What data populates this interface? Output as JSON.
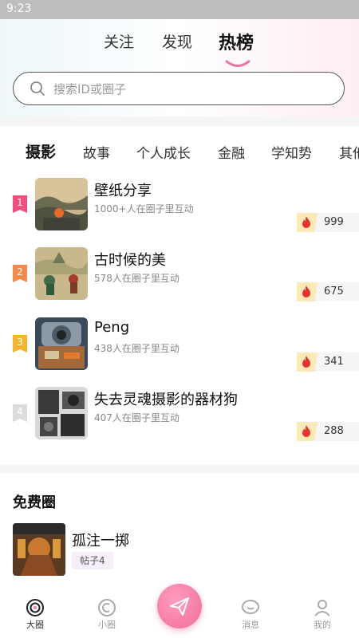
{
  "status_bar": {
    "time": "9:23"
  },
  "top_tabs": [
    {
      "label": "关注"
    },
    {
      "label": "发现"
    },
    {
      "label": "热榜"
    }
  ],
  "search": {
    "placeholder": "搜索ID或圈子"
  },
  "categories": [
    "摄影",
    "故事",
    "个人成长",
    "金融",
    "学知势",
    "其他"
  ],
  "ranking": [
    {
      "rank": "1",
      "name": "壁纸分享",
      "members": "1000+人在圈子里互动",
      "heat": "999",
      "badge_color": "#f0507e"
    },
    {
      "rank": "2",
      "name": "古时候的美",
      "members": "578人在圈子里互动",
      "heat": "675",
      "badge_color": "#f58a4a"
    },
    {
      "rank": "3",
      "name": "Peng",
      "members": "438人在圈子里互动",
      "heat": "341",
      "badge_color": "#f6b42a"
    },
    {
      "rank": "4",
      "name": "失去灵魂摄影的器材狗",
      "members": "407人在圈子里互动",
      "heat": "288",
      "badge_color": "#dcdcdc"
    }
  ],
  "free_section": {
    "title": "免费圈",
    "items": [
      {
        "name": "孤注一掷",
        "badge": "帖子4"
      }
    ]
  },
  "bottom_nav": [
    {
      "label": "大圈",
      "icon": "big-circle-icon"
    },
    {
      "label": "小圈",
      "icon": "small-circle-icon"
    },
    {
      "label": "",
      "icon": "paper-plane-icon"
    },
    {
      "label": "消息",
      "icon": "message-icon"
    },
    {
      "label": "我的",
      "icon": "profile-icon"
    }
  ],
  "colors": {
    "accent_pink": "#f77fa8",
    "fire_red": "#e8322b"
  }
}
